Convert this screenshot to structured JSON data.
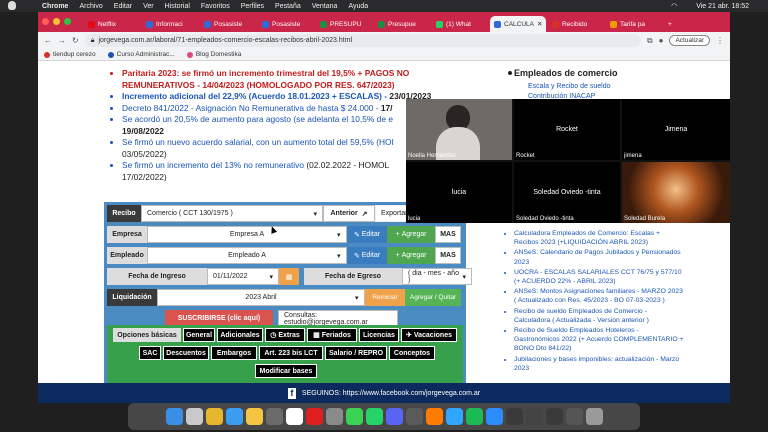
{
  "menubar": {
    "app": "Chrome",
    "items": [
      "Archivo",
      "Editar",
      "Ver",
      "Historial",
      "Favoritos",
      "Perfiles",
      "Pestaña",
      "Ventana",
      "Ayuda"
    ],
    "clock": "Vie 21 abr.  18:52"
  },
  "tabs": [
    {
      "label": "Netflix",
      "color": "#e50914"
    },
    {
      "label": "Informaci",
      "color": "#2f6bd8"
    },
    {
      "label": "Posasiste",
      "color": "#2f6bd8"
    },
    {
      "label": "Posasiste",
      "color": "#2f6bd8"
    },
    {
      "label": "PRESUPU",
      "color": "#1e8e3e"
    },
    {
      "label": "Presupue",
      "color": "#1e8e3e"
    },
    {
      "label": "(1) What",
      "color": "#25d366"
    },
    {
      "label": "CALCULA",
      "color": "#2f6bd8"
    },
    {
      "label": "Recibido",
      "color": "#d93025"
    },
    {
      "label": "Tarifa pa",
      "color": "#f29900"
    }
  ],
  "toolbar": {
    "url": "jorgevega.com.ar/laboral/71-empleados-comercio-escalas-recibos-abril-2023.html",
    "update_label": "Actualizar"
  },
  "bookmarks": [
    {
      "label": "tiendup cerezo",
      "color": "#d93025"
    },
    {
      "label": "Curso Administrac...",
      "color": "#1a55b4"
    },
    {
      "label": "Blog Domestika",
      "color": "#e0477b"
    }
  ],
  "content": {
    "line1": "Paritaria 2023: se firmó un incremento trimestral del 19,5% + PAGOS NO",
    "line1b": "REMUNERATIVOS - 14/04/2023 (HOMOLOGADO POR RES. 647/2023)",
    "line2": "Incremento adicional del 22,9% (Acuerdo 18.01.2023 + ESCALAS) -",
    "line2_date": "23/01/2023",
    "line3": "Decreto 841/2022 - Asignación No Remunerativa de hasta $ 24.000 -",
    "line3_date": "17/",
    "line4": "Se acordó un 20,5% de aumento para agosto (se adelanta el 10,5% de e",
    "line4_date": "19/08/2022",
    "line5": "Se firmó un nuevo acuerdo salarial, con un aumento total del 59,5% (HOI",
    "line5_date": "03/05/2022)",
    "line6": "Se firmó un incremento del 13% no remunerativo",
    "line6_tail": "(02.02.2022 - HOMOL",
    "line6_date": "17/02/2022)"
  },
  "calculator": {
    "recibo_label": "Recibo",
    "recibo_value": "Comercio ( CCT 130/1975 )",
    "anterior_label": "Anterior",
    "exportar_label": "Exportar",
    "empresa_label": "Empresa",
    "empresa_value": "Empresa A",
    "empleado_label": "Empleado",
    "empleado_value": "Empleado A",
    "editar_label": "Editar",
    "agregar_label": "Agregar",
    "mas_label": "MAS",
    "ingreso_label": "Fecha de Ingreso",
    "ingreso_value": "01/11/2022",
    "egreso_label": "Fecha de Egreso",
    "egreso_value": "( dia - mes - año )",
    "liquidacion_label": "Liquidación",
    "liquidacion_value": "2023 Abril",
    "reiniciar_label": "Reiniciar",
    "agregar_quitar_label": "Agregar / Quitar",
    "suscribirse_label": "SUSCRIBIRSE   (clic aquí)",
    "consultas_label": "Consultas: estudio@jorgevega.com.ar",
    "options": [
      "Opciones básicas",
      "General",
      "Adicionales",
      "Extras",
      "Feriados",
      "Licencias",
      "Vacaciones",
      "SAC",
      "Descuentos",
      "Embargos",
      "Art. 223 bis LCT",
      "Salario / REPRO",
      "Conceptos",
      "Modificar bases"
    ]
  },
  "sidebar": {
    "heading": "Empleados de comercio",
    "sub1": "Escala y Recibo de sueldo",
    "sub2": "Contribución INACAP",
    "links": [
      "Calculadora Empleados de Comercio: Escalas + Recibos 2023 (+LIQUIDACIÓN ABRIL 2023)",
      "ANSeS: Calendario de Pagos Jubilados y Pensionados 2023",
      "UOCRA - ESCALAS SALARIALES CCT 76/75 y 577/10 (+ ACUERDO 22% - ABRIL 2023)",
      "ANSeS: Montos Asignaciones familiares - MARZO 2023 ( Actualizado con Res. 45/2023 - BO 07-03-2023 )",
      "Recibo de sueldo Empleados de Comercio - Calculadora ( Actualizada - Versión anterior )",
      "Recibo de Sueldo Empleados Hoteleros - Gastronómicos 2022 (+ Acuerdo COMPLEMENTARIO + BONO Dto 841/22)",
      "Jubilaciones y bases imponibles: actualización - Marzo 2023"
    ]
  },
  "video": {
    "participants": [
      {
        "name": "Noelia Hernández",
        "center": ""
      },
      {
        "name": "Rocket",
        "center": "Rocket"
      },
      {
        "name": "jimena",
        "center": "Jimena"
      },
      {
        "name": "lucia",
        "center": "lucia"
      },
      {
        "name": "Soledad Oviedo -tinta",
        "center": "Soledad Oviedo -tinta"
      },
      {
        "name": "Soledad Burela",
        "center": ""
      }
    ]
  },
  "footer": {
    "text": "SEGUINOS: https://www.facebook.com/jorgevega.com.ar"
  },
  "dock": {
    "icons": [
      "finder-icon",
      "launchpad-icon",
      "chrome-icon",
      "safari-icon",
      "photos-icon",
      "files-icon",
      "calendar-icon",
      "acrobat-icon",
      "system-icon",
      "messages-icon",
      "whatsapp-icon",
      "discord-icon",
      "app-icon",
      "illustrator-icon",
      "photoshop-icon",
      "spotify-icon",
      "zoom-icon",
      "window1-icon",
      "window2-icon",
      "window3-icon",
      "window4-icon",
      "trash-icon"
    ],
    "colors": [
      "#3a8ee6",
      "#c9c9c9",
      "#e6b62f",
      "#3b9cf0",
      "#f4c542",
      "#6b6b6b",
      "#ffffff",
      "#e02020",
      "#8a8a8a",
      "#3bd154",
      "#25d366",
      "#5865f2",
      "#5a5a5a",
      "#ff7c00",
      "#2fa6ff",
      "#1db954",
      "#2d8cff",
      "#3a3a3a",
      "#444",
      "#3a3a3a",
      "#555",
      "#9a9a9a"
    ]
  }
}
